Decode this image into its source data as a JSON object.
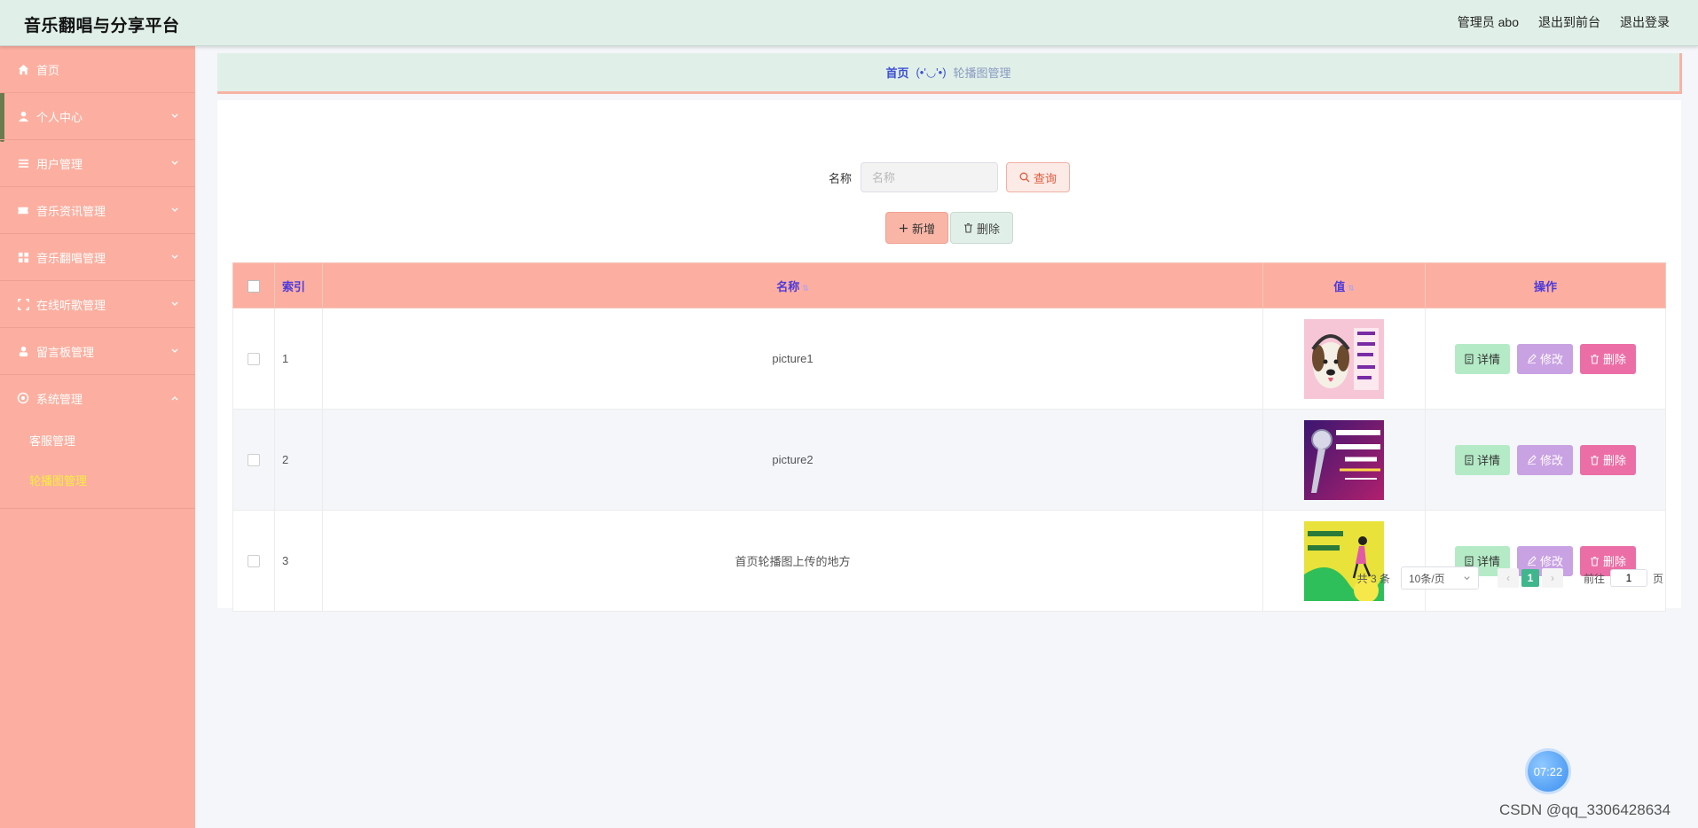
{
  "header": {
    "title": "音乐翻唱与分享平台",
    "admin_label": "管理员 abo",
    "to_front": "退出到前台",
    "logout": "退出登录"
  },
  "sidebar": {
    "items": [
      {
        "label": "首页",
        "icon": "home-icon"
      },
      {
        "label": "个人中心",
        "icon": "user-icon"
      },
      {
        "label": "用户管理",
        "icon": "list-icon"
      },
      {
        "label": "音乐资讯管理",
        "icon": "ticket-icon"
      },
      {
        "label": "音乐翻唱管理",
        "icon": "grid-icon"
      },
      {
        "label": "在线听歌管理",
        "icon": "scan-icon"
      },
      {
        "label": "留言板管理",
        "icon": "person-icon"
      },
      {
        "label": "系统管理",
        "icon": "gear-icon"
      }
    ],
    "system_sub": [
      {
        "label": "客服管理"
      },
      {
        "label": "轮播图管理",
        "active": true
      }
    ]
  },
  "breadcrumb": {
    "home": "首页",
    "face": "(•'◡'•)",
    "current": "轮播图管理"
  },
  "search": {
    "label": "名称",
    "placeholder": "名称",
    "query_button": "查询"
  },
  "actions": {
    "add": "新增",
    "delete": "删除"
  },
  "table": {
    "headers": {
      "index": "索引",
      "name": "名称",
      "value": "值",
      "ops": "操作"
    },
    "rows": [
      {
        "index": "1",
        "name": "picture1"
      },
      {
        "index": "2",
        "name": "picture2"
      },
      {
        "index": "3",
        "name": "首页轮播图上传的地方"
      }
    ],
    "row_actions": {
      "detail": "详情",
      "edit": "修改",
      "delete": "删除"
    }
  },
  "pagination": {
    "total": "共 3 条",
    "page_size": "10条/页",
    "current": "1",
    "goto_prefix": "前往",
    "goto_value": "1",
    "goto_suffix": "页"
  },
  "overlay": {
    "clock": "07:22",
    "watermark": "CSDN @qq_3306428634"
  },
  "colors": {
    "header_bg": "#e0f0e8",
    "sidebar_bg": "#fcafa0",
    "table_head_bg": "#fcafa0",
    "header_text": "#4d3adb",
    "active_sub": "#f6ee3c",
    "detail_btn": "#b4ebc6",
    "edit_btn": "#c9a2e3",
    "delete_btn": "#ec6ea6",
    "pager_active": "#3fb68b"
  }
}
